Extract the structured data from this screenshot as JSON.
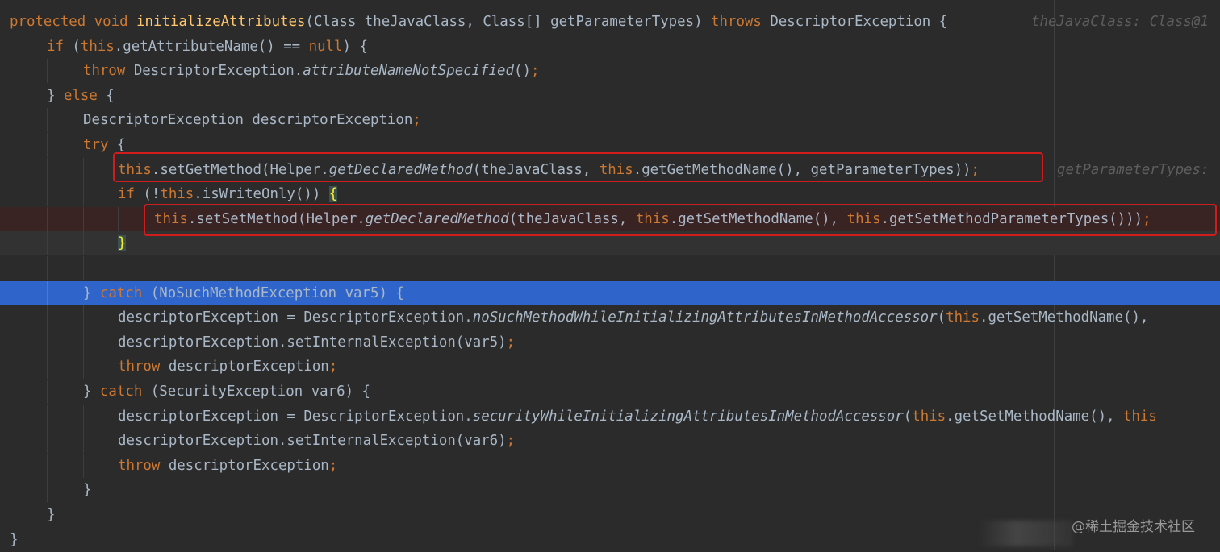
{
  "editor": {
    "lines": [
      {
        "id": "l1",
        "tokens": [
          {
            "t": "protected void ",
            "c": "kw"
          },
          {
            "t": "initializeAttributes",
            "c": "fn"
          },
          {
            "t": "(Class theJavaClass, Class[] getParameterTypes) ",
            "c": ""
          },
          {
            "t": "throws ",
            "c": "kw"
          },
          {
            "t": "DescriptorException {",
            "c": ""
          }
        ]
      },
      {
        "id": "l2",
        "tokens": [
          {
            "t": "if ",
            "c": "kw"
          },
          {
            "t": "(",
            "c": ""
          },
          {
            "t": "this",
            "c": "kw"
          },
          {
            "t": ".getAttributeName() == ",
            "c": ""
          },
          {
            "t": "null",
            "c": "kw"
          },
          {
            "t": ") {",
            "c": ""
          }
        ]
      },
      {
        "id": "l3",
        "tokens": [
          {
            "t": "throw ",
            "c": "kw"
          },
          {
            "t": "DescriptorException.",
            "c": ""
          },
          {
            "t": "attributeNameNotSpecified",
            "c": "it"
          },
          {
            "t": "()",
            "c": ""
          },
          {
            "t": ";",
            "c": "kw"
          }
        ]
      },
      {
        "id": "l4",
        "tokens": [
          {
            "t": "} ",
            "c": ""
          },
          {
            "t": "else ",
            "c": "kw"
          },
          {
            "t": "{",
            "c": ""
          }
        ]
      },
      {
        "id": "l5",
        "tokens": [
          {
            "t": "DescriptorException descriptorException",
            "c": ""
          },
          {
            "t": ";",
            "c": "kw"
          }
        ]
      },
      {
        "id": "l6",
        "tokens": [
          {
            "t": "try ",
            "c": "kw"
          },
          {
            "t": "{",
            "c": ""
          }
        ]
      },
      {
        "id": "l7",
        "tokens": [
          {
            "t": "this",
            "c": "kw"
          },
          {
            "t": ".setGetMethod(Helper.",
            "c": ""
          },
          {
            "t": "getDeclaredMethod",
            "c": "it"
          },
          {
            "t": "(theJavaClass, ",
            "c": ""
          },
          {
            "t": "this",
            "c": "kw"
          },
          {
            "t": ".getGetMethodName(), getParameterTypes))",
            "c": ""
          },
          {
            "t": ";",
            "c": "kw"
          }
        ]
      },
      {
        "id": "l8",
        "tokens": [
          {
            "t": "if ",
            "c": "kw"
          },
          {
            "t": "(!",
            "c": ""
          },
          {
            "t": "this",
            "c": "kw"
          },
          {
            "t": ".isWriteOnly()) ",
            "c": ""
          },
          {
            "t": "{",
            "c": "brace-hl"
          }
        ]
      },
      {
        "id": "l9",
        "tokens": [
          {
            "t": "this",
            "c": "kw"
          },
          {
            "t": ".setSetMethod(Helper.",
            "c": ""
          },
          {
            "t": "getDeclaredMethod",
            "c": "it"
          },
          {
            "t": "(theJavaClass, ",
            "c": ""
          },
          {
            "t": "this",
            "c": "kw"
          },
          {
            "t": ".getSetMethodName(), ",
            "c": ""
          },
          {
            "t": "this",
            "c": "kw"
          },
          {
            "t": ".getSetMethodParameterTypes()))",
            "c": ""
          },
          {
            "t": ";",
            "c": "kw"
          }
        ]
      },
      {
        "id": "l10",
        "tokens": [
          {
            "t": "}",
            "c": "brace-hl"
          }
        ]
      },
      {
        "id": "l11",
        "tokens": []
      },
      {
        "id": "l12",
        "tokens": [
          {
            "t": "} ",
            "c": ""
          },
          {
            "t": "catch ",
            "c": "kw"
          },
          {
            "t": "(NoSuchMethodException var5) {",
            "c": ""
          }
        ]
      },
      {
        "id": "l13",
        "tokens": [
          {
            "t": "descriptorException = DescriptorException.",
            "c": ""
          },
          {
            "t": "noSuchMethodWhileInitializingAttributesInMethodAccessor",
            "c": "it"
          },
          {
            "t": "(",
            "c": ""
          },
          {
            "t": "this",
            "c": "kw"
          },
          {
            "t": ".getSetMethodName(),",
            "c": ""
          }
        ]
      },
      {
        "id": "l14",
        "tokens": [
          {
            "t": "descriptorException.setInternalException(var5)",
            "c": ""
          },
          {
            "t": ";",
            "c": "kw"
          }
        ]
      },
      {
        "id": "l15",
        "tokens": [
          {
            "t": "throw ",
            "c": "kw"
          },
          {
            "t": "descriptorException",
            "c": ""
          },
          {
            "t": ";",
            "c": "kw"
          }
        ]
      },
      {
        "id": "l16",
        "tokens": [
          {
            "t": "} ",
            "c": ""
          },
          {
            "t": "catch ",
            "c": "kw"
          },
          {
            "t": "(SecurityException var6) {",
            "c": ""
          }
        ]
      },
      {
        "id": "l17",
        "tokens": [
          {
            "t": "descriptorException = DescriptorException.",
            "c": ""
          },
          {
            "t": "securityWhileInitializingAttributesInMethodAccessor",
            "c": "it"
          },
          {
            "t": "(",
            "c": ""
          },
          {
            "t": "this",
            "c": "kw"
          },
          {
            "t": ".getSetMethodName(), ",
            "c": ""
          },
          {
            "t": "this",
            "c": "kw"
          }
        ]
      },
      {
        "id": "l18",
        "tokens": [
          {
            "t": "descriptorException.setInternalException(var6)",
            "c": ""
          },
          {
            "t": ";",
            "c": "kw"
          }
        ]
      },
      {
        "id": "l19",
        "tokens": [
          {
            "t": "throw ",
            "c": "kw"
          },
          {
            "t": "descriptorException",
            "c": ""
          },
          {
            "t": ";",
            "c": "kw"
          }
        ]
      },
      {
        "id": "l20",
        "tokens": [
          {
            "t": "}",
            "c": ""
          }
        ]
      },
      {
        "id": "l21",
        "tokens": [
          {
            "t": "}",
            "c": ""
          }
        ]
      },
      {
        "id": "l22",
        "tokens": [
          {
            "t": "}",
            "c": ""
          }
        ]
      }
    ],
    "hints": {
      "l1": "theJavaClass: Class@1",
      "l7": "getParameterTypes:"
    }
  },
  "colors": {
    "background": "#2b2b2b",
    "keyword": "#cc7832",
    "method_declaration": "#ffc66d",
    "text": "#a9b7c6",
    "selection": "#2f65ca",
    "annotation_box": "#d11c1c"
  },
  "watermark": "@稀土掘金技术社区"
}
